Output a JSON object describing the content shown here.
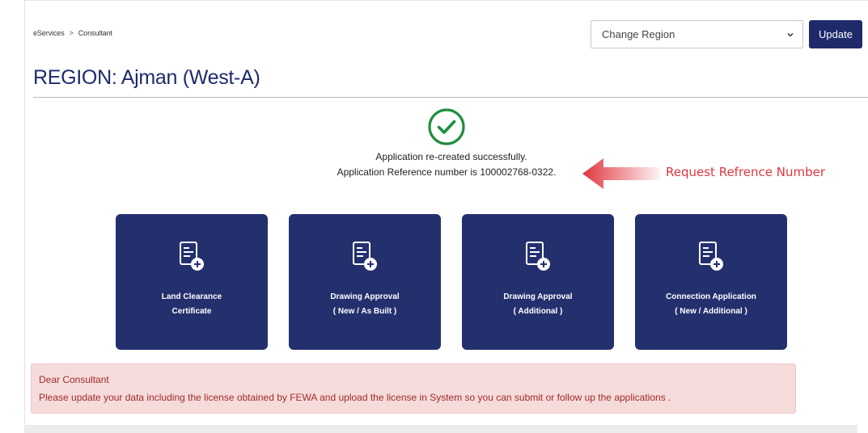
{
  "breadcrumb": {
    "item1": "eServices",
    "separator": ">",
    "item2": "Consultant"
  },
  "region_select": {
    "selected": "Change Region"
  },
  "update_button": {
    "label": "Update"
  },
  "page_title": "REGION: Ajman (West-A)",
  "success": {
    "message_line1": "Application re-created successfully.",
    "message_line2": "Application Reference number is 100002768-0322."
  },
  "annotation": {
    "label": "Request Refrence Number",
    "color": "#e0363f"
  },
  "cards": [
    {
      "line1": "Land Clearance",
      "line2": "Certificate"
    },
    {
      "line1": "Drawing Approval",
      "line2": "( New / As Built )"
    },
    {
      "line1": "Drawing Approval",
      "line2": "( Additional )"
    },
    {
      "line1": "Connection Application",
      "line2": "( New / Additional )"
    }
  ],
  "alert": {
    "heading": "Dear Consultant",
    "text": "Please update your data including the license obtained by FEWA and upload the license in System so you can submit or follow up the applications ."
  },
  "colors": {
    "brand": "#1f2a6b",
    "card": "#24306e",
    "success": "#1e8e3e",
    "alert_bg": "#f5dcdb",
    "alert_text": "#a22a2a"
  },
  "icons": [
    "chevron-down-icon",
    "success-check-icon",
    "arrow-left-icon",
    "document-add-icon"
  ]
}
